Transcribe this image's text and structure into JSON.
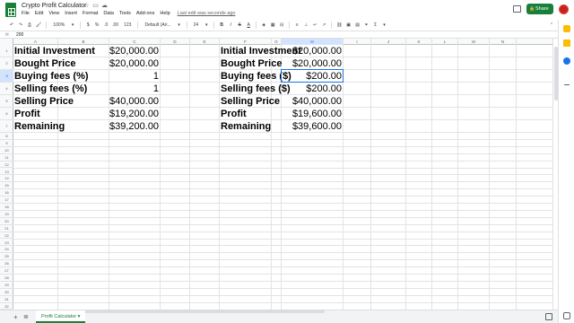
{
  "title_bar": {
    "doc_title": "Crypto Profit Calculator",
    "icons": [
      "star-icon",
      "move-folder-icon",
      "cloud-status-icon"
    ],
    "menu": [
      "File",
      "Edit",
      "View",
      "Insert",
      "Format",
      "Data",
      "Tools",
      "Add-ons",
      "Help"
    ],
    "last_edit": "Last edit was seconds ago",
    "share_label": "Share"
  },
  "toolbar": {
    "zoom": "100%",
    "currency": "$",
    "percent": "%",
    "dec_decrease": ".0",
    "dec_increase": ".00",
    "more_formats": "123",
    "font": "Default (Ari...",
    "font_size": "24"
  },
  "formula_bar": {
    "fx": "fx",
    "value": "200"
  },
  "grid": {
    "columns": [
      "A",
      "B",
      "C",
      "D",
      "E",
      "F",
      "G",
      "H",
      "I",
      "J",
      "K",
      "L",
      "M",
      "N"
    ],
    "selected_column": "H",
    "selected_row": "3",
    "rows": [
      "1",
      "2",
      "3",
      "4",
      "5",
      "6",
      "7",
      "8",
      "9",
      "10",
      "11",
      "12",
      "13",
      "14",
      "15",
      "16",
      "17",
      "18",
      "19",
      "20",
      "21",
      "22",
      "23",
      "24",
      "25",
      "26",
      "27",
      "28",
      "29",
      "30",
      "31",
      "32",
      "33",
      "34",
      "35"
    ],
    "left_table": [
      {
        "label": "Initial Investment",
        "value": "$20,000.00"
      },
      {
        "label": "Bought Price",
        "value": "$20,000.00"
      },
      {
        "label": "Buying fees (%)",
        "value": "1"
      },
      {
        "label": "Selling fees (%)",
        "value": "1"
      },
      {
        "label": "Selling Price",
        "value": "$40,000.00"
      },
      {
        "label": "Profit",
        "value": "$19,200.00"
      },
      {
        "label": "Remaining",
        "value": "$39,200.00"
      }
    ],
    "right_table": [
      {
        "label": "Initial Investment",
        "value": "$20,000.00"
      },
      {
        "label": "Bought Price",
        "value": "$20,000.00"
      },
      {
        "label": "Buying fees ($)",
        "value": "$200.00"
      },
      {
        "label": "Selling fees ($)",
        "value": "$200.00"
      },
      {
        "label": "Selling Price",
        "value": "$40,000.00"
      },
      {
        "label": "Profit",
        "value": "$19,600.00"
      },
      {
        "label": "Remaining",
        "value": "$39,600.00"
      }
    ]
  },
  "bottom_bar": {
    "sheet_tab": "Profit Calculator"
  },
  "colors": {
    "accent_green": "#188038",
    "selection_blue": "#1a73e8"
  }
}
